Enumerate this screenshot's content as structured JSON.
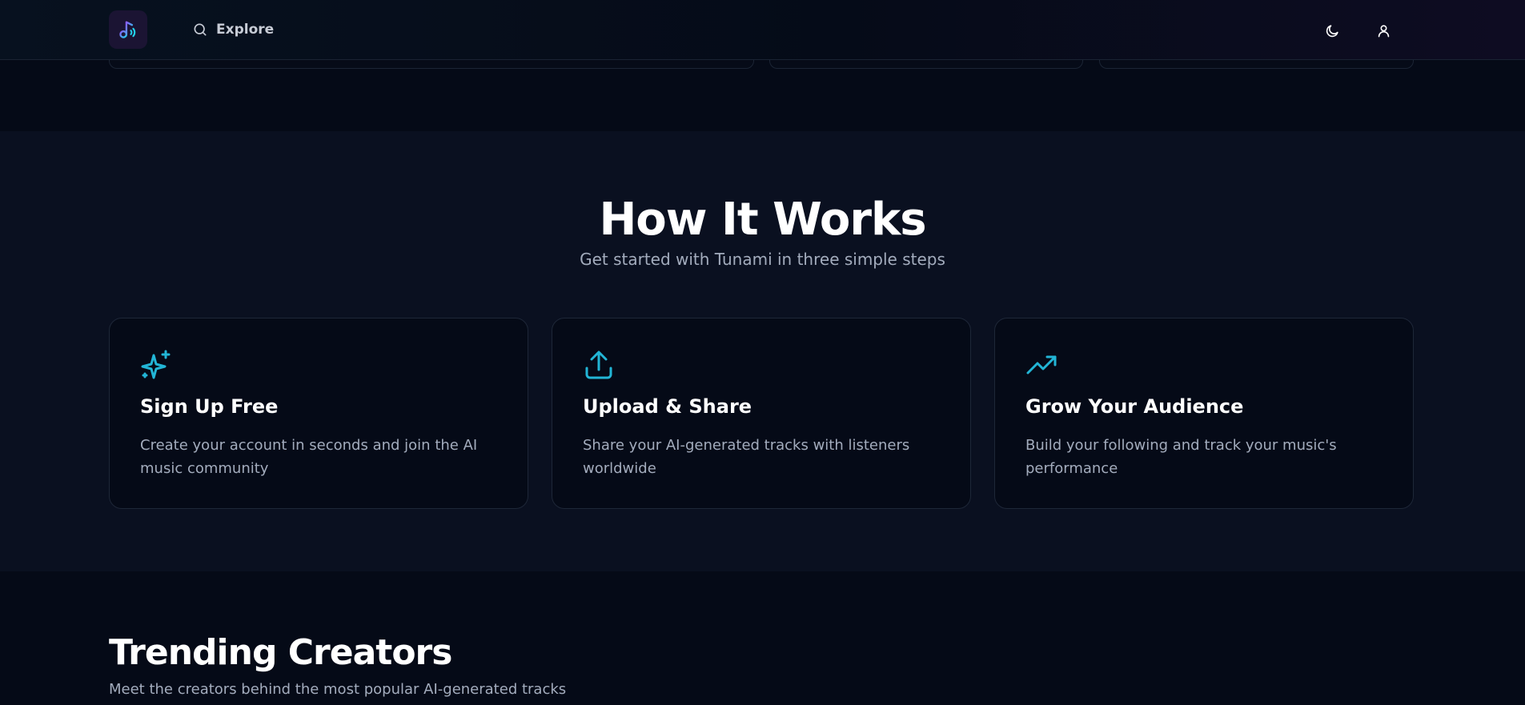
{
  "header": {
    "logo_icon": "music-note-icon",
    "explore_label": "Explore",
    "search_icon": "search-icon",
    "theme_icon": "moon-icon",
    "user_icon": "user-icon"
  },
  "colors": {
    "accent": "#22b5d6",
    "logo_bg": "#1b1433",
    "background": "#050a17",
    "section_bg": "#0a1020"
  },
  "how_it_works": {
    "title": "How It Works",
    "subtitle": "Get started with Tunami in three simple steps",
    "steps": [
      {
        "icon": "sparkles-icon",
        "title": "Sign Up Free",
        "description": "Create your account in seconds and join the AI music community"
      },
      {
        "icon": "upload-icon",
        "title": "Upload & Share",
        "description": "Share your AI-generated tracks with listeners worldwide"
      },
      {
        "icon": "trending-up-icon",
        "title": "Grow Your Audience",
        "description": "Build your following and track your music's performance"
      }
    ]
  },
  "trending": {
    "title": "Trending Creators",
    "subtitle": "Meet the creators behind the most popular AI-generated tracks"
  }
}
